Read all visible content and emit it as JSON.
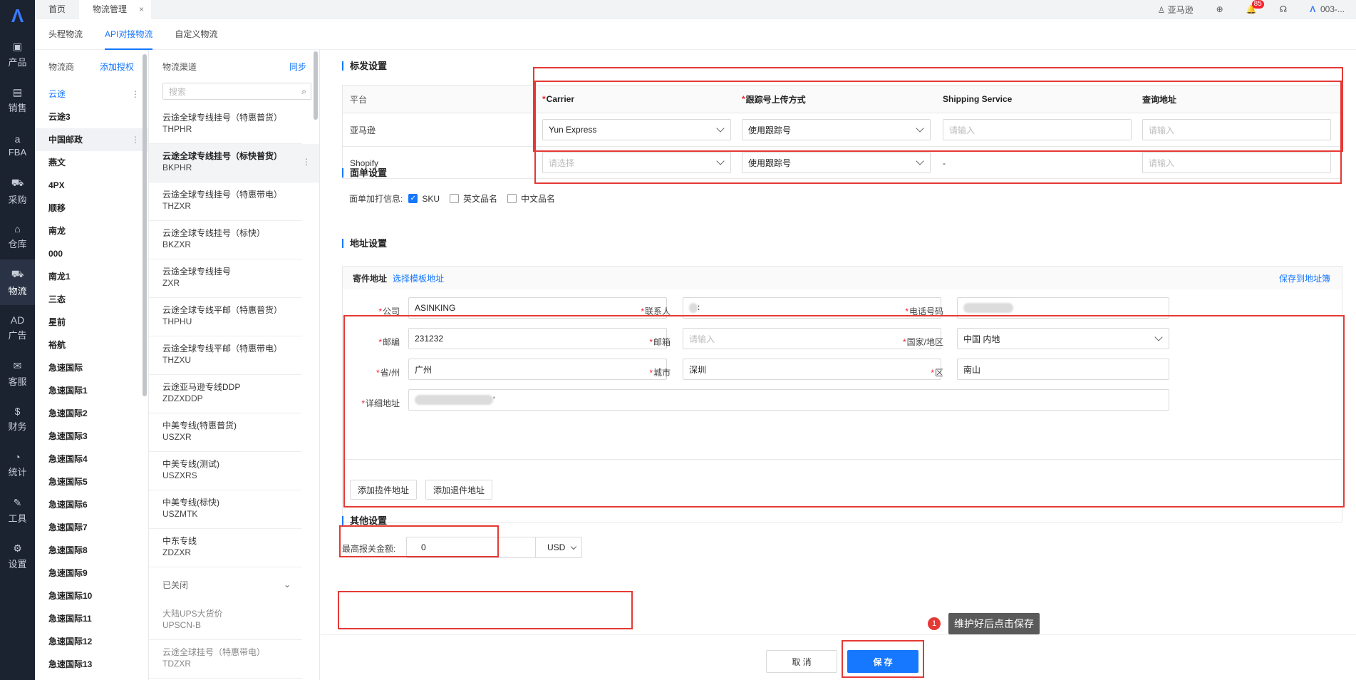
{
  "rail": {
    "items": [
      {
        "label": "产品",
        "icon": "bag-icon"
      },
      {
        "label": "销售",
        "icon": "sell-icon"
      },
      {
        "label": "FBA",
        "icon": "fba-icon"
      },
      {
        "label": "采购",
        "icon": "cart-icon"
      },
      {
        "label": "仓库",
        "icon": "warehouse-icon"
      },
      {
        "label": "物流",
        "icon": "truck-icon"
      },
      {
        "label": "广告",
        "icon": "ad-icon"
      },
      {
        "label": "客服",
        "icon": "mail-icon"
      },
      {
        "label": "财务",
        "icon": "finance-icon"
      },
      {
        "label": "统计",
        "icon": "pie-icon"
      },
      {
        "label": "工具",
        "icon": "wrench-icon"
      },
      {
        "label": "设置",
        "icon": "gear-icon"
      }
    ]
  },
  "topbar": {
    "tabs": [
      "首页",
      "物流管理"
    ],
    "store": "亚马逊",
    "notify_count": "85",
    "account": "003-..."
  },
  "subtabs": [
    "头程物流",
    "API对接物流",
    "自定义物流"
  ],
  "carriers": {
    "title": "物流商",
    "add_link": "添加授权",
    "items": [
      "云途",
      "云途3",
      "中国邮政",
      "燕文",
      "4PX",
      "顺移",
      "南龙",
      "000",
      "南龙1",
      "三态",
      "星前",
      "裕航",
      "急速国际",
      "急速国际1",
      "急速国际2",
      "急速国际3",
      "急速国际4",
      "急速国际5",
      "急速国际6",
      "急速国际7",
      "急速国际8",
      "急速国际9",
      "急速国际10",
      "急速国际11",
      "急速国际12",
      "急速国际13"
    ]
  },
  "channels": {
    "title": "物流渠道",
    "sync_link": "同步",
    "search_placeholder": "搜索",
    "items": [
      {
        "name": "云途全球专线挂号（特惠普货）",
        "code": "THPHR"
      },
      {
        "name": "云途全球专线挂号（标快普货）",
        "code": "BKPHR"
      },
      {
        "name": "云途全球专线挂号（特惠带电）",
        "code": "THZXR"
      },
      {
        "name": "云途全球专线挂号（标快）",
        "code": "BKZXR"
      },
      {
        "name": "云途全球专线挂号",
        "code": "ZXR"
      },
      {
        "name": "云途全球专线平邮（特惠普货）",
        "code": "THPHU"
      },
      {
        "name": "云途全球专线平邮（特惠带电）",
        "code": "THZXU"
      },
      {
        "name": "云途亚马逊专线DDP",
        "code": "ZDZXDDP"
      },
      {
        "name": "中美专线(特惠普货)",
        "code": "USZXR"
      },
      {
        "name": "中美专线(测试)",
        "code": "USZXRS"
      },
      {
        "name": "中美专线(标快)",
        "code": "USZMTK"
      },
      {
        "name": "中东专线",
        "code": "ZDZXR"
      }
    ],
    "closed_label": "已关闭",
    "closed_items": [
      {
        "name": "大陆UPS大货价",
        "code": "UPSCN-B"
      },
      {
        "name": "云途全球挂号（特惠带电）",
        "code": "TDZXR"
      }
    ]
  },
  "shipping": {
    "title": "标发设置",
    "headers": {
      "platform": "平台",
      "carrier": "Carrier",
      "upload": "跟踪号上传方式",
      "service": "Shipping Service",
      "query": "查询地址"
    },
    "rows": [
      {
        "platform": "亚马逊",
        "carrier": "Yun Express",
        "carrier_ph": "",
        "upload": "使用跟踪号",
        "service_ph": "请输入",
        "service_text": "",
        "query_ph": "请输入"
      },
      {
        "platform": "Shopify",
        "carrier": "",
        "carrier_ph": "请选择",
        "upload": "使用跟踪号",
        "service_ph": "",
        "service_text": "-",
        "query_ph": "请输入"
      }
    ]
  },
  "label": {
    "title": "面单设置",
    "print_label": "面单加打信息:",
    "options": [
      {
        "text": "SKU",
        "checked": true
      },
      {
        "text": "英文品名",
        "checked": false
      },
      {
        "text": "中文品名",
        "checked": false
      }
    ]
  },
  "address": {
    "title": "地址设置",
    "sender_label": "寄件地址",
    "template_link": "选择模板地址",
    "save_link": "保存到地址簿",
    "fields": {
      "company_label": "公司",
      "company": "ASINKING",
      "contact_label": "联系人",
      "contact": "∶",
      "phone_label": "电话号码",
      "zip_label": "邮编",
      "zip": "231232",
      "email_label": "邮箱",
      "email_ph": "请输入",
      "country_label": "国家/地区",
      "country": "中国 内地",
      "province_label": "省/州",
      "province": "广州",
      "city_label": "城市",
      "city": "深圳",
      "district_label": "区",
      "district": "南山",
      "detail_label": "详细地址",
      "detail": "'"
    },
    "add_pickup": "添加揽件地址",
    "add_return": "添加退件地址"
  },
  "other": {
    "title": "其他设置",
    "max_label": "最高报关金额:",
    "max_value": "0",
    "currency": "USD"
  },
  "footer": {
    "cancel": "取 消",
    "save": "保 存"
  },
  "annotation": {
    "num": "1",
    "text": "维护好后点击保存"
  }
}
